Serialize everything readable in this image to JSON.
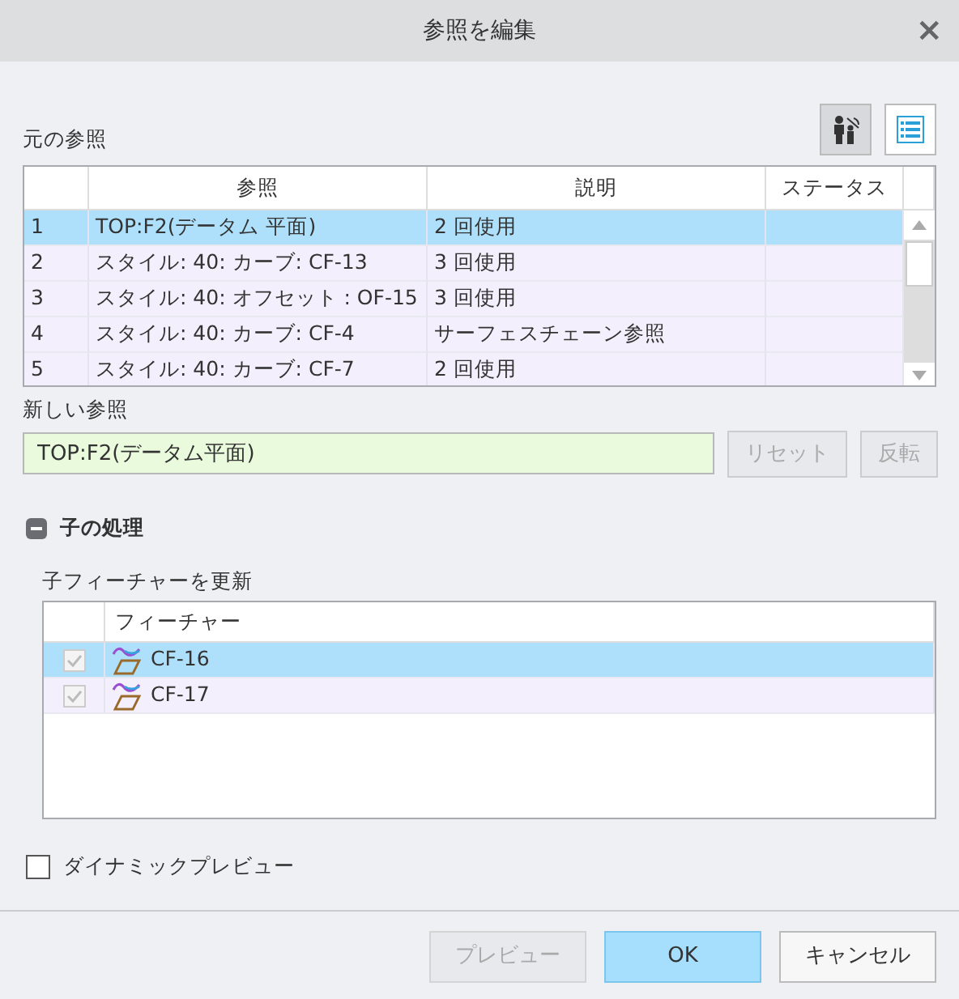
{
  "window": {
    "title": "参照を編集",
    "close": "×"
  },
  "original_refs": {
    "label": "元の参照",
    "columns": [
      "参照",
      "説明",
      "ステータス"
    ],
    "rows": [
      {
        "number": "1",
        "reference": "TOP:F2(データム 平面)",
        "description": "2 回使用",
        "selected": true
      },
      {
        "number": "2",
        "reference": "スタイル: 40: カーブ: CF-13",
        "description": "3 回使用",
        "selected": false
      },
      {
        "number": "3",
        "reference": "スタイル: 40: オフセット : OF-15",
        "description": "3 回使用",
        "selected": false
      },
      {
        "number": "4",
        "reference": "スタイル: 40: カーブ: CF-4",
        "description": "サーフェスチェーン参照",
        "selected": false
      },
      {
        "number": "5",
        "reference": "スタイル: 40: カーブ: CF-7",
        "description": "2 回使用",
        "selected": false
      }
    ]
  },
  "new_ref": {
    "label": "新しい参照",
    "value": "TOP:F2(データム平面)",
    "buttons": [
      {
        "label": "リセット",
        "disabled": true
      },
      {
        "label": "反転",
        "disabled": true
      }
    ]
  },
  "children": {
    "title": "子の処理",
    "expanded": true,
    "sublabel": "子フィーチャーを更新",
    "column": "フィーチャー",
    "rows": [
      {
        "name": "CF-16",
        "checked": true,
        "selected": true
      },
      {
        "name": "CF-17",
        "checked": true,
        "selected": false
      }
    ]
  },
  "dynamic_preview": {
    "label": "ダイナミックプレビュー",
    "checked": false
  },
  "footer": [
    {
      "label": "プレビュー",
      "kind": "normal",
      "disabled": true
    },
    {
      "label": "OK",
      "kind": "primary",
      "disabled": false
    },
    {
      "label": "キャンセル",
      "kind": "normal",
      "disabled": false
    }
  ]
}
